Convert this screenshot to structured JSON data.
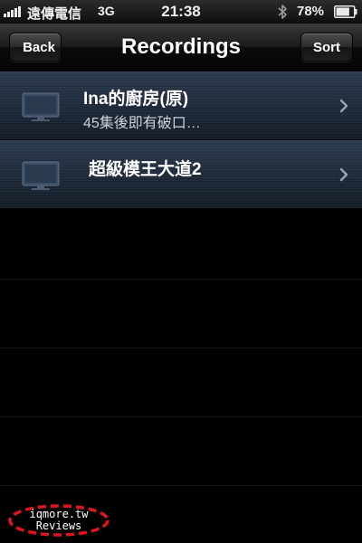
{
  "status_bar": {
    "carrier": "遠傳電信",
    "network": "3G",
    "time": "21:38",
    "battery": "78%",
    "battery_level": 0.78,
    "signal_bars": 5,
    "icons": [
      "signal-icon",
      "bluetooth-icon",
      "battery-icon"
    ]
  },
  "nav_bar": {
    "title": "Recordings",
    "back_label": "Back",
    "sort_label": "Sort"
  },
  "recordings": [
    {
      "title": "Ina的廚房(原)",
      "subtitle": "45集後即有破口…",
      "icon": "tv-icon"
    },
    {
      "title": "超級模王大道2",
      "subtitle": "",
      "icon": "tv-icon"
    }
  ],
  "watermark": {
    "line1": "iqmore.tw",
    "line2": "Reviews",
    "color": "#e1141e"
  },
  "colors": {
    "background": "#000000",
    "row_top": "#2b3a4e",
    "row_bottom": "#141c27",
    "subtitle": "#c9d2de"
  }
}
